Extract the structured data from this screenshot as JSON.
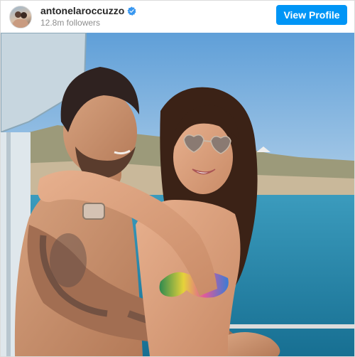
{
  "profile": {
    "username": "antonelaroccuzzo",
    "followers": "12.8m followers",
    "verified": true,
    "avatar_icon": "profile-avatar"
  },
  "actions": {
    "view_profile_label": "View Profile"
  },
  "colors": {
    "button_blue": "#0095f6",
    "verified_blue": "#3897f0",
    "username_text": "#262626",
    "followers_text": "#8e8e8e",
    "sky": "#7fb1de",
    "sea": "#2c8fb0"
  },
  "post": {
    "image_icon": "couple-on-boat-photo"
  }
}
